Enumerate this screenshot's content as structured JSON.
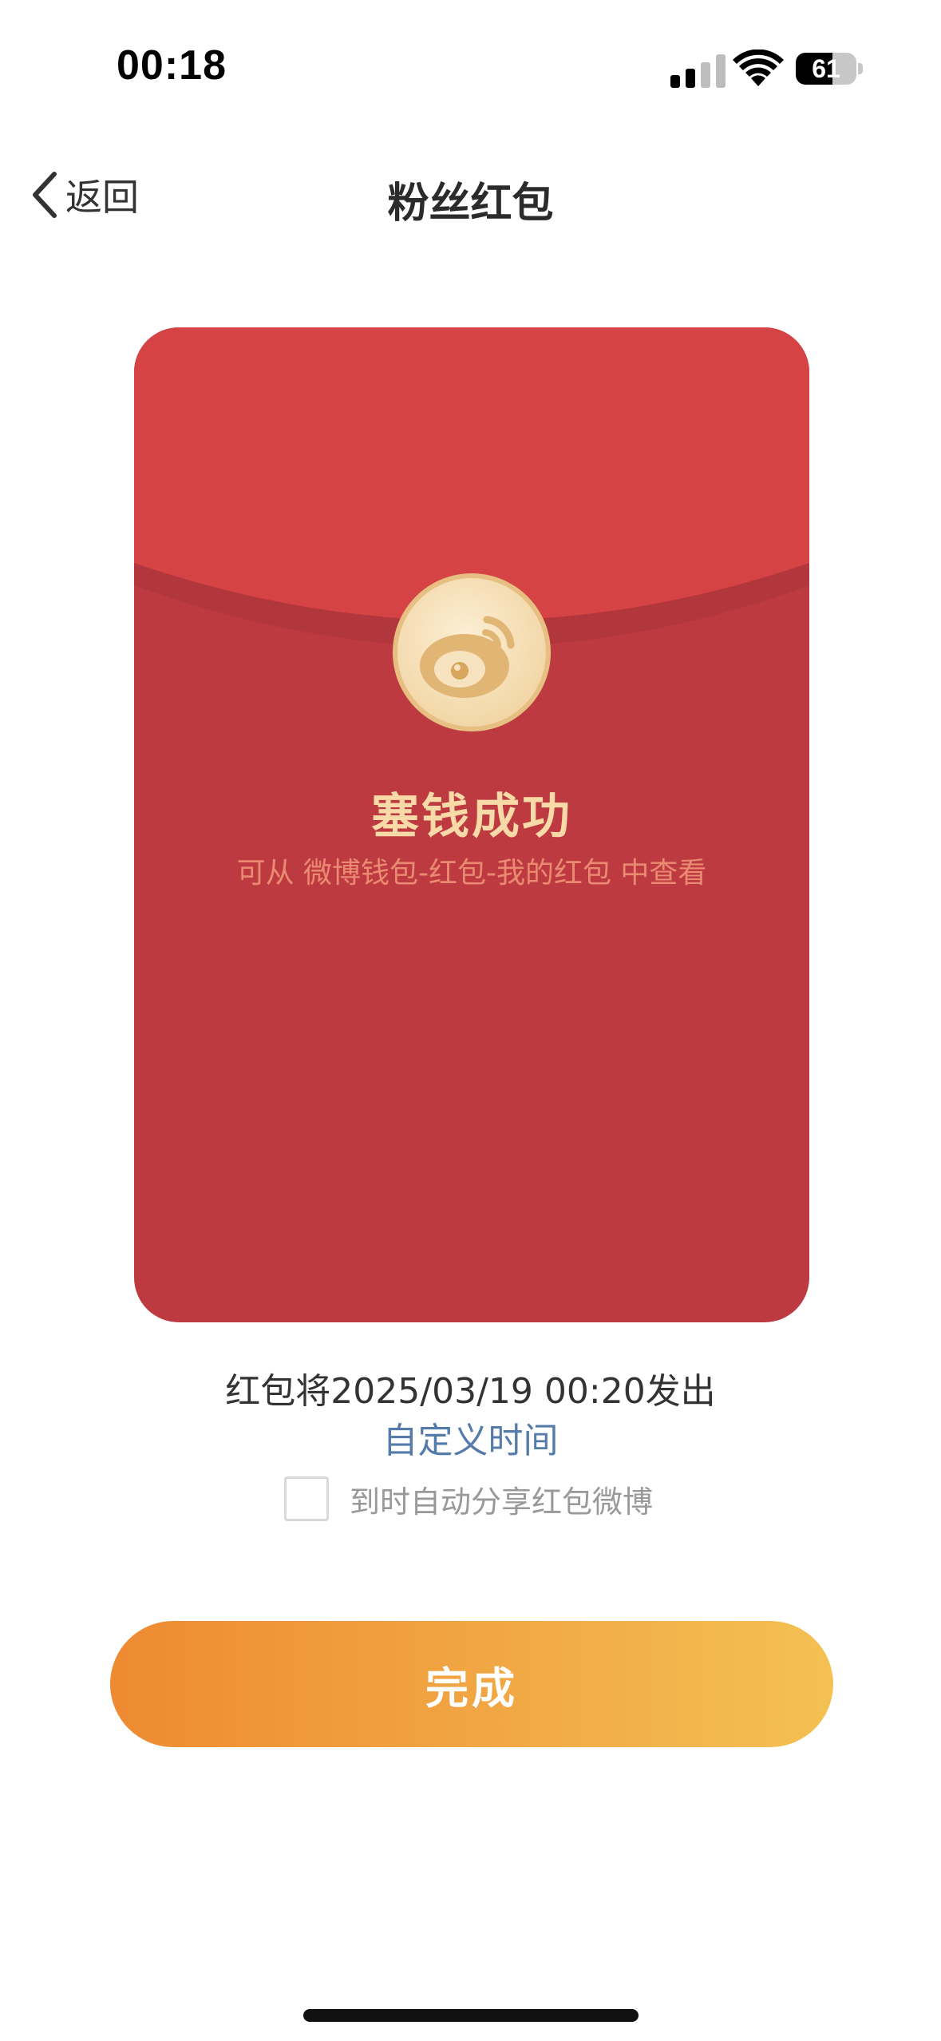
{
  "status_bar": {
    "time": "00:18",
    "battery": "61",
    "battery_level": 0.61
  },
  "nav": {
    "back_label": "返回",
    "title": "粉丝红包"
  },
  "envelope": {
    "title": "塞钱成功",
    "hint": "可从 微博钱包-红包-我的红包 中查看"
  },
  "schedule": {
    "send_time_text": "红包将2025/03/19 00:20发出",
    "custom_time_link": "自定义时间",
    "auto_share_label": "到时自动分享红包微博",
    "auto_share_checked": false
  },
  "actions": {
    "done_label": "完成"
  },
  "colors": {
    "envelope_red": "#bd3a40",
    "flap_red": "#d54344",
    "gold_text": "#f8d9a8",
    "link_blue": "#557bab",
    "button_orange_start": "#ee8a32",
    "button_orange_end": "#f4c152"
  },
  "icons": {
    "back": "chevron-left-icon",
    "cellular": "cellular-signal-icon",
    "wifi": "wifi-icon",
    "battery": "battery-icon",
    "weibo": "weibo-logo-icon"
  }
}
